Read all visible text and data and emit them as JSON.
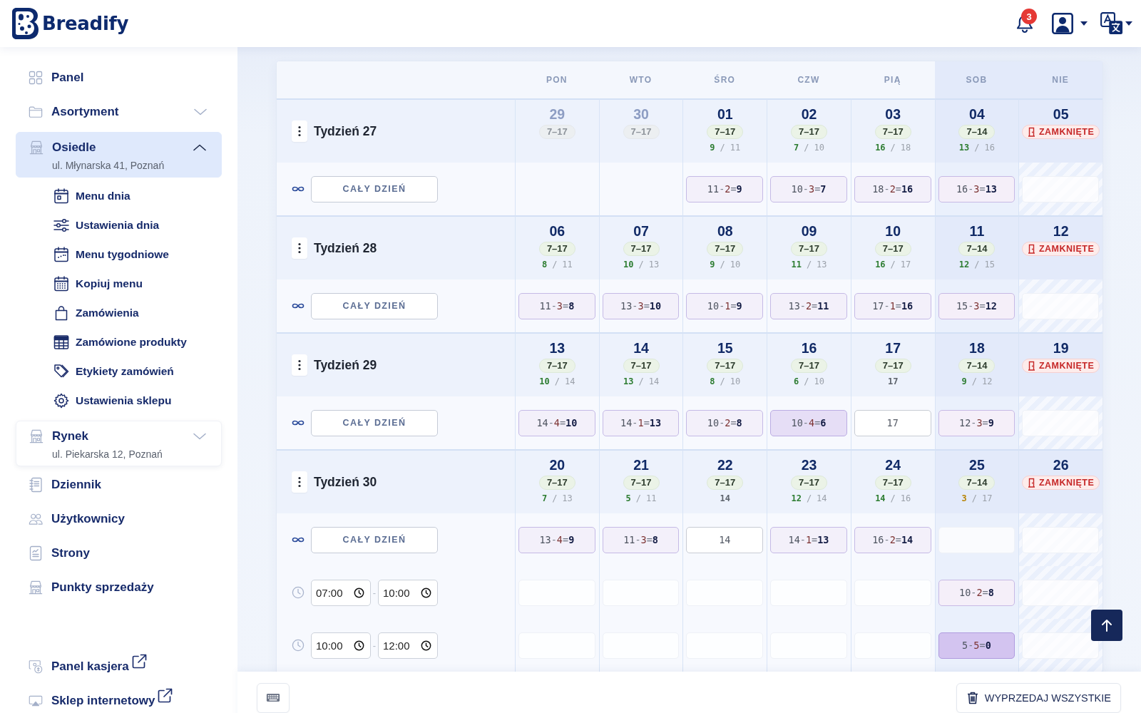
{
  "header": {
    "logo": "Breadify",
    "notification_count": "3"
  },
  "sidebar": {
    "items": [
      {
        "kind": "link",
        "label": "Panel",
        "selected": false
      },
      {
        "kind": "folder",
        "label": "Asortyment",
        "selected": false,
        "expanded": false
      },
      {
        "kind": "store",
        "label": "Osiedle",
        "subtitle": "ul. Młynarska 41, Poznań",
        "selected": true,
        "expanded": true,
        "children": [
          {
            "label": "Menu dnia",
            "selected": false
          },
          {
            "label": "Ustawienia dnia",
            "selected": false
          },
          {
            "label": "Menu tygodniowe",
            "selected": false
          },
          {
            "label": "Kopiuj menu",
            "selected": false
          },
          {
            "label": "Zamówienia",
            "selected": false
          },
          {
            "label": "Zamówione produkty",
            "selected": false
          },
          {
            "label": "Etykiety zamówień",
            "selected": false
          },
          {
            "label": "Ustawienia sklepu",
            "selected": false
          }
        ]
      },
      {
        "kind": "store",
        "label": "Rynek",
        "subtitle": "ul. Piekarska 12, Poznań",
        "selected": false,
        "expanded": false
      },
      {
        "kind": "link",
        "label": "Dziennik",
        "selected": false
      },
      {
        "kind": "link",
        "label": "Użytkownicy",
        "selected": false
      },
      {
        "kind": "link",
        "label": "Strony",
        "selected": false
      },
      {
        "kind": "link",
        "label": "Punkty sprzedaży",
        "selected": false
      }
    ],
    "external_links": [
      {
        "label": "Panel kasjera"
      },
      {
        "label": "Sklep internetowy"
      }
    ]
  },
  "calendar": {
    "weekdays": [
      {
        "label": "PON",
        "weekend": false
      },
      {
        "label": "WTO",
        "weekend": false
      },
      {
        "label": "ŚRO",
        "weekend": false
      },
      {
        "label": "CZW",
        "weekend": false
      },
      {
        "label": "PIĄ",
        "weekend": false
      },
      {
        "label": "SOB",
        "weekend": true
      },
      {
        "label": "NIE",
        "weekend": true
      }
    ],
    "weeks": [
      {
        "label": "Tydzień 27",
        "days": [
          {
            "date": "29",
            "outside_month": true,
            "closed": false,
            "hours": "7–17"
          },
          {
            "date": "30",
            "outside_month": true,
            "closed": false,
            "hours": "7–17"
          },
          {
            "date": "01",
            "outside_month": false,
            "closed": false,
            "hours": "7–17",
            "count": {
              "value": "9",
              "separator": "/",
              "total": "11",
              "color": "#2e7d32"
            }
          },
          {
            "date": "02",
            "outside_month": false,
            "closed": false,
            "hours": "7–17",
            "count": {
              "value": "7",
              "separator": "/",
              "total": "10",
              "color": "#2e7d32"
            }
          },
          {
            "date": "03",
            "outside_month": false,
            "closed": false,
            "hours": "7–17",
            "count": {
              "value": "16",
              "separator": "/",
              "total": "18",
              "color": "#2e7d32"
            }
          },
          {
            "date": "04",
            "outside_month": false,
            "closed": false,
            "hours": "7–14",
            "count": {
              "value": "13",
              "separator": "/",
              "total": "16",
              "color": "#2e7d32"
            }
          },
          {
            "date": "05",
            "outside_month": false,
            "closed": true,
            "closed_label": "ZAMKNIĘTE"
          }
        ],
        "rows": [
          {
            "kind": "all_day",
            "button": "CAŁY DZIEŃ",
            "cells": [
              {
                "kind": "blank"
              },
              {
                "kind": "blank"
              },
              {
                "kind": "formula",
                "parts": [
                  "11",
                  "-",
                  "2",
                  "=",
                  "9"
                ],
                "color": "#f3f0fa"
              },
              {
                "kind": "formula",
                "parts": [
                  "10",
                  "-",
                  "3",
                  "=",
                  "7"
                ],
                "color": "#f3f0fa"
              },
              {
                "kind": "formula",
                "parts": [
                  "18",
                  "-",
                  "2",
                  "=",
                  "16"
                ],
                "color": "#f3f0fa"
              },
              {
                "kind": "formula",
                "parts": [
                  "16",
                  "-",
                  "3",
                  "=",
                  "13"
                ],
                "color": "#f5eff9"
              },
              {
                "kind": "empty"
              }
            ]
          }
        ]
      },
      {
        "label": "Tydzień 28",
        "days": [
          {
            "date": "06",
            "outside_month": false,
            "closed": false,
            "hours": "7–17",
            "count": {
              "value": "8",
              "separator": "/",
              "total": "11",
              "color": "#2e7d32"
            }
          },
          {
            "date": "07",
            "outside_month": false,
            "closed": false,
            "hours": "7–17",
            "count": {
              "value": "10",
              "separator": "/",
              "total": "13",
              "color": "#2e7d32"
            }
          },
          {
            "date": "08",
            "outside_month": false,
            "closed": false,
            "hours": "7–17",
            "count": {
              "value": "9",
              "separator": "/",
              "total": "10",
              "color": "#2e7d32"
            }
          },
          {
            "date": "09",
            "outside_month": false,
            "closed": false,
            "hours": "7–17",
            "count": {
              "value": "11",
              "separator": "/",
              "total": "13",
              "color": "#2e7d32"
            }
          },
          {
            "date": "10",
            "outside_month": false,
            "closed": false,
            "hours": "7–17",
            "count": {
              "value": "16",
              "separator": "/",
              "total": "17",
              "color": "#2e7d32"
            }
          },
          {
            "date": "11",
            "outside_month": false,
            "closed": false,
            "hours": "7–14",
            "count": {
              "value": "12",
              "separator": "/",
              "total": "15",
              "color": "#2e7d32"
            }
          },
          {
            "date": "12",
            "outside_month": false,
            "closed": true,
            "closed_label": "ZAMKNIĘTE"
          }
        ],
        "rows": [
          {
            "kind": "all_day",
            "button": "CAŁY DZIEŃ",
            "cells": [
              {
                "kind": "formula",
                "parts": [
                  "11",
                  "-",
                  "3",
                  "=",
                  "8"
                ],
                "color": "#f3f0fa"
              },
              {
                "kind": "formula",
                "parts": [
                  "13",
                  "-",
                  "3",
                  "=",
                  "10"
                ],
                "color": "#f3f0fa"
              },
              {
                "kind": "formula",
                "parts": [
                  "10",
                  "-",
                  "1",
                  "=",
                  "9"
                ],
                "color": "#f3f0fa"
              },
              {
                "kind": "formula",
                "parts": [
                  "13",
                  "-",
                  "2",
                  "=",
                  "11"
                ],
                "color": "#f3f0fa"
              },
              {
                "kind": "formula",
                "parts": [
                  "17",
                  "-",
                  "1",
                  "=",
                  "16"
                ],
                "color": "#f3f0fa"
              },
              {
                "kind": "formula",
                "parts": [
                  "15",
                  "-",
                  "3",
                  "=",
                  "12"
                ],
                "color": "#f5eff9"
              },
              {
                "kind": "empty"
              }
            ]
          }
        ]
      },
      {
        "label": "Tydzień 29",
        "days": [
          {
            "date": "13",
            "outside_month": false,
            "closed": false,
            "hours": "7–17",
            "count": {
              "value": "10",
              "separator": "/",
              "total": "14",
              "color": "#2e7d32"
            }
          },
          {
            "date": "14",
            "outside_month": false,
            "closed": false,
            "hours": "7–17",
            "count": {
              "value": "13",
              "separator": "/",
              "total": "14",
              "color": "#2e7d32"
            }
          },
          {
            "date": "15",
            "outside_month": false,
            "closed": false,
            "hours": "7–17",
            "count": {
              "value": "8",
              "separator": "/",
              "total": "10",
              "color": "#2e7d32"
            }
          },
          {
            "date": "16",
            "outside_month": false,
            "closed": false,
            "hours": "7–17",
            "count": {
              "value": "6",
              "separator": "/",
              "total": "10",
              "color": "#2e7d32"
            }
          },
          {
            "date": "17",
            "outside_month": false,
            "closed": false,
            "hours": "7–17",
            "count": {
              "value": "17",
              "color": "#5d636c"
            }
          },
          {
            "date": "18",
            "outside_month": false,
            "closed": false,
            "hours": "7–14",
            "count": {
              "value": "9",
              "separator": "/",
              "total": "12",
              "color": "#2e7d32"
            }
          },
          {
            "date": "19",
            "outside_month": false,
            "closed": true,
            "closed_label": "ZAMKNIĘTE"
          }
        ],
        "rows": [
          {
            "kind": "all_day",
            "button": "CAŁY DZIEŃ",
            "cells": [
              {
                "kind": "formula",
                "parts": [
                  "14",
                  "-",
                  "4",
                  "=",
                  "10"
                ],
                "color": "#f3f0fa"
              },
              {
                "kind": "formula",
                "parts": [
                  "14",
                  "-",
                  "1",
                  "=",
                  "13"
                ],
                "color": "#f3f0fa"
              },
              {
                "kind": "formula",
                "parts": [
                  "10",
                  "-",
                  "2",
                  "=",
                  "8"
                ],
                "color": "#f3f0fa"
              },
              {
                "kind": "formula",
                "parts": [
                  "10",
                  "-",
                  "4",
                  "=",
                  "6"
                ],
                "color": "#e6def6"
              },
              {
                "kind": "number",
                "text": "17"
              },
              {
                "kind": "formula",
                "parts": [
                  "12",
                  "-",
                  "3",
                  "=",
                  "9"
                ],
                "color": "#f5eff9"
              },
              {
                "kind": "empty"
              }
            ]
          }
        ]
      },
      {
        "label": "Tydzień 30",
        "days": [
          {
            "date": "20",
            "outside_month": false,
            "closed": false,
            "hours": "7–17",
            "count": {
              "value": "7",
              "separator": "/",
              "total": "13",
              "color": "#2e7d32"
            }
          },
          {
            "date": "21",
            "outside_month": false,
            "closed": false,
            "hours": "7–17",
            "count": {
              "value": "5",
              "separator": "/",
              "total": "11",
              "color": "#2e7d32"
            }
          },
          {
            "date": "22",
            "outside_month": false,
            "closed": false,
            "hours": "7–17",
            "count": {
              "value": "14",
              "color": "#5d636c"
            }
          },
          {
            "date": "23",
            "outside_month": false,
            "closed": false,
            "hours": "7–17",
            "count": {
              "value": "12",
              "separator": "/",
              "total": "14",
              "color": "#2e7d32"
            }
          },
          {
            "date": "24",
            "outside_month": false,
            "closed": false,
            "hours": "7–17",
            "count": {
              "value": "14",
              "separator": "/",
              "total": "16",
              "color": "#2e7d32"
            }
          },
          {
            "date": "25",
            "outside_month": false,
            "closed": false,
            "hours": "7–14",
            "count": {
              "value": "3",
              "separator": "/",
              "total": "17",
              "color": "#b8860b"
            }
          },
          {
            "date": "26",
            "outside_month": false,
            "closed": true,
            "closed_label": "ZAMKNIĘTE"
          }
        ],
        "rows": [
          {
            "kind": "all_day",
            "button": "CAŁY DZIEŃ",
            "cells": [
              {
                "kind": "formula",
                "parts": [
                  "13",
                  "-",
                  "4",
                  "=",
                  "9"
                ],
                "color": "#f3f0fa"
              },
              {
                "kind": "formula",
                "parts": [
                  "11",
                  "-",
                  "3",
                  "=",
                  "8"
                ],
                "color": "#f3f0fa"
              },
              {
                "kind": "number",
                "text": "14"
              },
              {
                "kind": "formula",
                "parts": [
                  "14",
                  "-",
                  "1",
                  "=",
                  "13"
                ],
                "color": "#f3f0fa"
              },
              {
                "kind": "formula",
                "parts": [
                  "16",
                  "-",
                  "2",
                  "=",
                  "14"
                ],
                "color": "#f3f0fa"
              },
              {
                "kind": "empty"
              },
              {
                "kind": "empty"
              }
            ]
          },
          {
            "kind": "time",
            "from": "07:00",
            "separator": "-",
            "to": "10:00",
            "cells": [
              {
                "kind": "empty"
              },
              {
                "kind": "empty"
              },
              {
                "kind": "empty"
              },
              {
                "kind": "empty"
              },
              {
                "kind": "empty"
              },
              {
                "kind": "formula",
                "parts": [
                  "10",
                  "-",
                  "2",
                  "=",
                  "8"
                ],
                "color": "#f5eff9"
              },
              {
                "kind": "empty"
              }
            ]
          },
          {
            "kind": "time",
            "from": "10:00",
            "separator": "-",
            "to": "12:00",
            "cells": [
              {
                "kind": "empty"
              },
              {
                "kind": "empty"
              },
              {
                "kind": "empty"
              },
              {
                "kind": "empty"
              },
              {
                "kind": "empty"
              },
              {
                "kind": "formula",
                "parts": [
                  "5",
                  "-",
                  "5",
                  "=",
                  "0"
                ],
                "color": "#d3c4f0"
              },
              {
                "kind": "empty"
              }
            ]
          }
        ]
      }
    ]
  },
  "footer": {
    "sell_all_button": "WYPRZEDAJ WSZYSTKIE"
  }
}
